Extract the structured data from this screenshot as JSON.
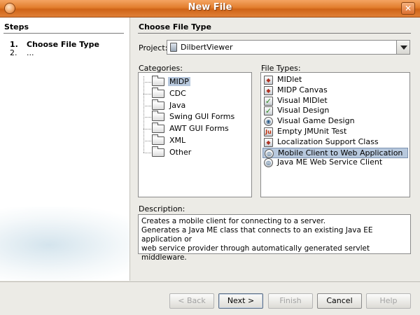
{
  "window": {
    "title": "New File",
    "close_glyph": "✕"
  },
  "steps": {
    "title": "Steps",
    "items": [
      {
        "num": "1.",
        "label": "Choose File Type"
      },
      {
        "num": "2.",
        "label": "..."
      }
    ]
  },
  "content": {
    "title": "Choose File Type",
    "project_label": "Project:",
    "project_value": "DilbertViewer",
    "categories_label": "Categories:",
    "filetypes_label": "File Types:",
    "description_label": "Description:"
  },
  "categories": [
    "MIDP",
    "CDC",
    "Java",
    "Swing GUI Forms",
    "AWT GUI Forms",
    "XML",
    "Other"
  ],
  "selected_category": "MIDP",
  "file_types": [
    {
      "label": "MIDlet",
      "icon": "midlet-icon",
      "glyph": "◆"
    },
    {
      "label": "MIDP Canvas",
      "icon": "canvas-icon",
      "glyph": "◆"
    },
    {
      "label": "Visual MIDlet",
      "icon": "visual-midlet-icon",
      "glyph": "✓"
    },
    {
      "label": "Visual Design",
      "icon": "visual-design-icon",
      "glyph": "✓"
    },
    {
      "label": "Visual Game Design",
      "icon": "game-design-icon",
      "glyph": "◉"
    },
    {
      "label": "Empty JMUnit Test",
      "icon": "junit-icon",
      "glyph": "Ju"
    },
    {
      "label": "Localization Support Class",
      "icon": "localization-icon",
      "glyph": "◆"
    },
    {
      "label": "Mobile Client to Web Application",
      "icon": "web-client-icon",
      "glyph": "◎"
    },
    {
      "label": "Java ME Web Service Client",
      "icon": "web-service-icon",
      "glyph": "◎"
    }
  ],
  "selected_file_type": "Mobile Client to Web Application",
  "description": [
    "Creates a mobile client for connecting to a server.",
    "Generates a Java ME class that connects to an existing Java EE application or",
    "web service provider through automatically generated servlet middleware."
  ],
  "buttons": {
    "back": "< Back",
    "next": "Next >",
    "finish": "Finish",
    "cancel": "Cancel",
    "help": "Help"
  }
}
